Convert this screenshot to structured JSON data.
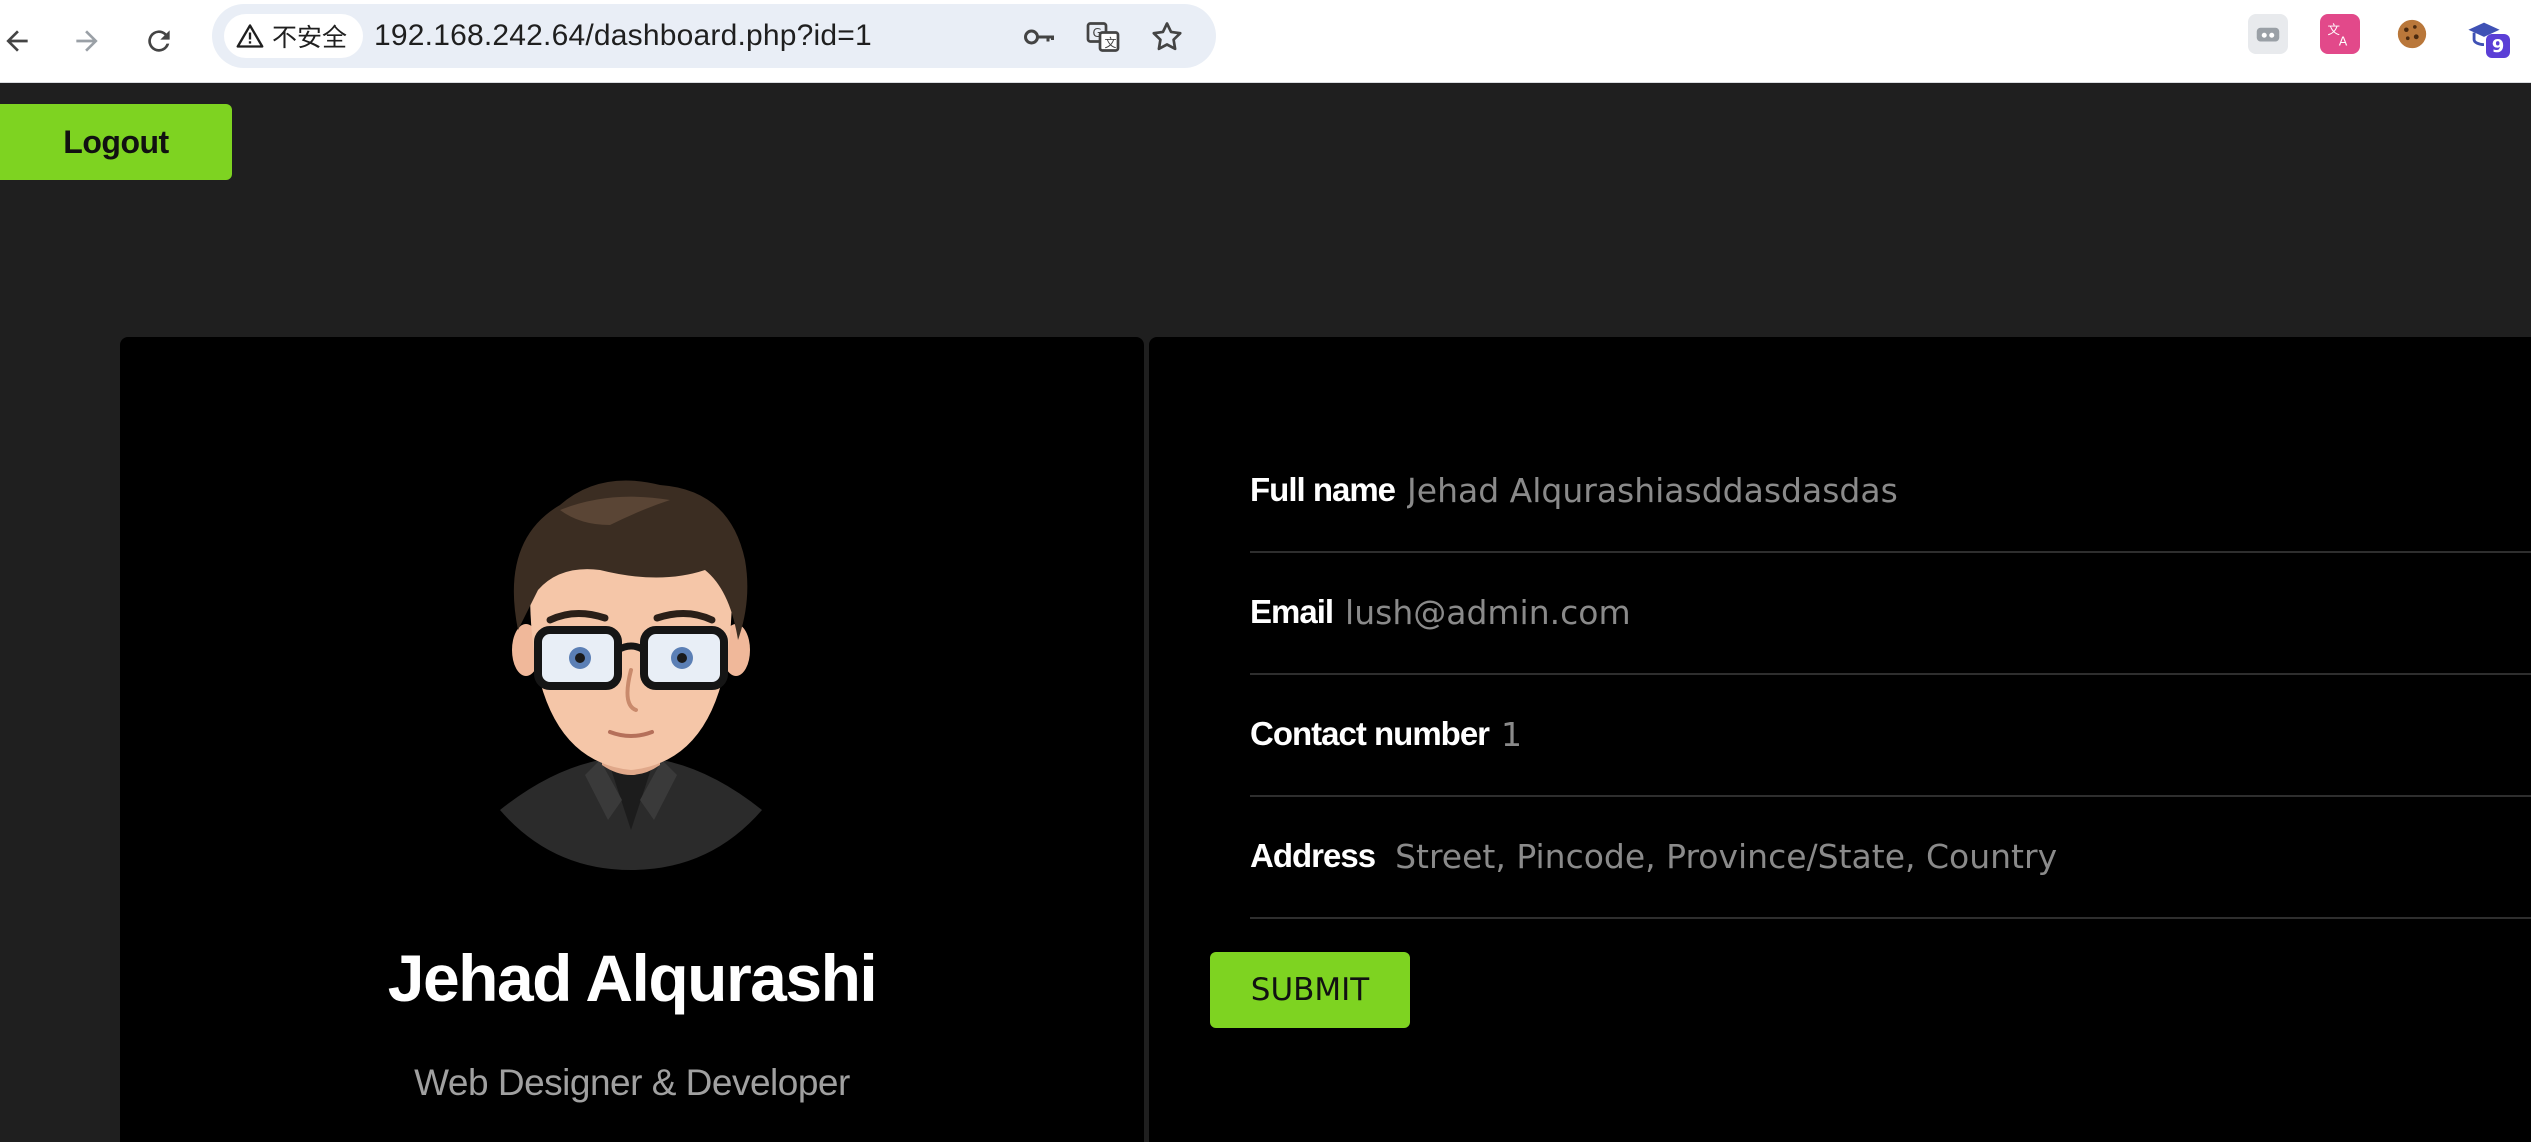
{
  "browser": {
    "security_label": "不安全",
    "url": "192.168.242.64/dashboard.php?id=1",
    "extension_badge": "9"
  },
  "header": {
    "logout_label": "Logout"
  },
  "profile": {
    "name": "Jehad Alqurashi",
    "role": "Web Designer & Developer"
  },
  "form": {
    "full_name": {
      "label": "Full name",
      "value": "Jehad Alqurashiasddasdasdas"
    },
    "email": {
      "label": "Email",
      "value": "lush@admin.com"
    },
    "contact": {
      "label": "Contact number",
      "value": "1"
    },
    "address": {
      "label": "Address",
      "placeholder": "Street, Pincode, Province/State, Country"
    },
    "submit_label": "SUBMIT"
  },
  "colors": {
    "accent": "#7ed321",
    "page_bg": "#1f1f1f",
    "card_bg": "#000000"
  }
}
